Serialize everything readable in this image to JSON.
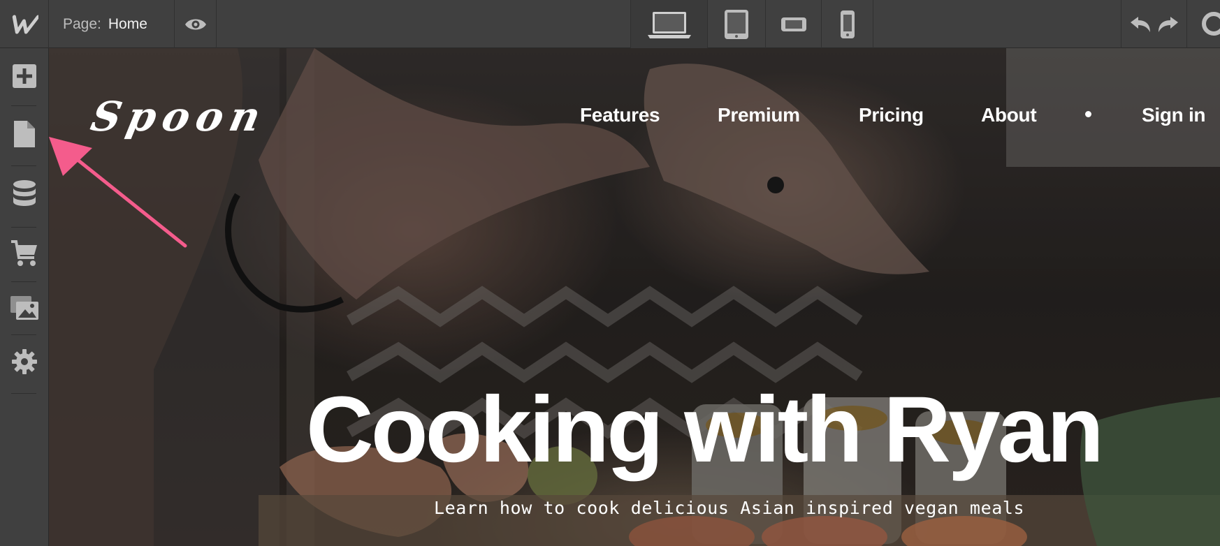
{
  "app": {
    "logo_letter": "W"
  },
  "toolbar": {
    "page_label": "Page:",
    "page_name": "Home",
    "preview_icon": "eye-icon",
    "devices": [
      {
        "name": "desktop",
        "icon": "laptop-icon",
        "active": true
      },
      {
        "name": "tablet",
        "icon": "tablet-icon",
        "active": false
      },
      {
        "name": "mobile-landscape",
        "icon": "phone-landscape-icon",
        "active": false
      },
      {
        "name": "mobile-portrait",
        "icon": "phone-portrait-icon",
        "active": false
      }
    ],
    "history_icons": [
      "undo-icon",
      "redo-icon"
    ]
  },
  "sidebar": {
    "items": [
      {
        "name": "add",
        "icon": "plus-icon"
      },
      {
        "name": "pages",
        "icon": "page-icon"
      },
      {
        "name": "cms",
        "icon": "database-icon"
      },
      {
        "name": "ecommerce",
        "icon": "cart-icon"
      },
      {
        "name": "assets",
        "icon": "images-icon"
      },
      {
        "name": "settings",
        "icon": "gear-icon"
      }
    ]
  },
  "site": {
    "logo_text": "Spoon",
    "nav": [
      "Features",
      "Premium",
      "Pricing",
      "About",
      "Sign in"
    ],
    "hero_title": "Cooking with Ryan",
    "hero_subtitle": "Learn how to cook delicious Asian inspired vegan meals"
  },
  "annotation": {
    "arrow_color": "#f45c8c",
    "target": "pages"
  },
  "colors": {
    "toolbar_bg": "#404040",
    "icon_color": "#bfbfbf",
    "text_color": "#ffffff"
  }
}
